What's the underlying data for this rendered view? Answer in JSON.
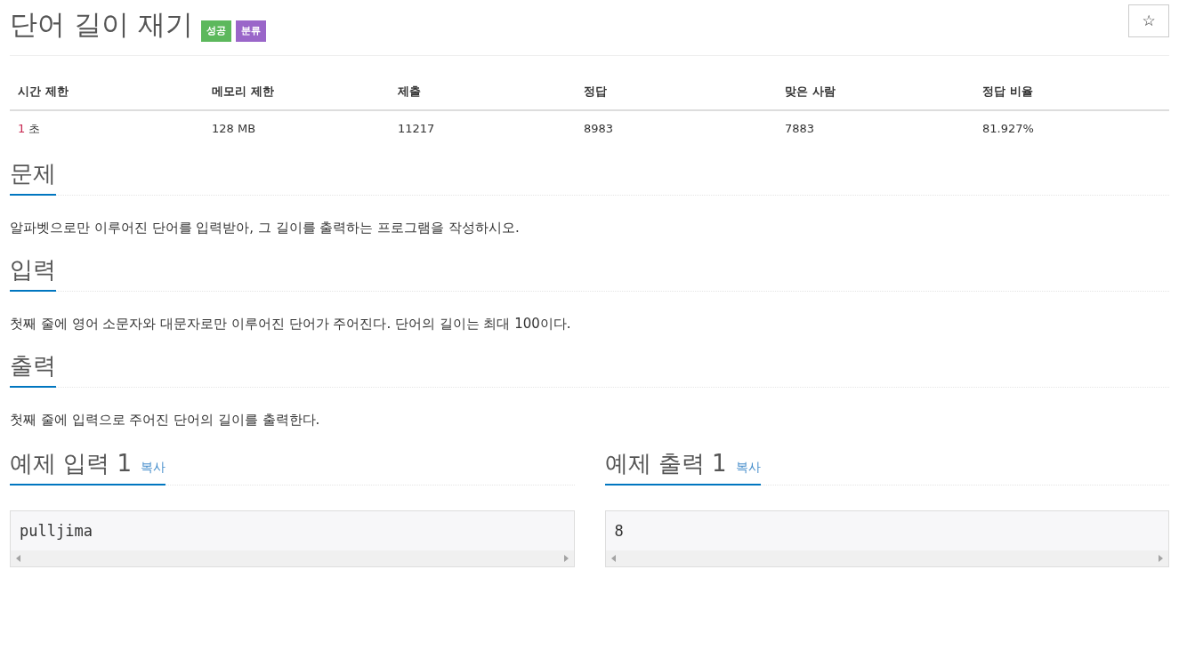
{
  "title": "단어 길이 재기",
  "badges": [
    {
      "label": "성공",
      "color": "#5cb85c"
    },
    {
      "label": "분류",
      "color": "#9a66c9"
    }
  ],
  "star_button": {
    "label": "☆"
  },
  "info_table": {
    "columns": [
      "시간 제한",
      "메모리 제한",
      "제출",
      "정답",
      "맞은 사람",
      "정답 비율"
    ],
    "row": [
      {
        "number": "1",
        "unit": "초"
      },
      {
        "text": "128 MB"
      },
      {
        "text": "11217"
      },
      {
        "text": "8983"
      },
      {
        "text": "7883"
      },
      {
        "text": "81.927%"
      }
    ]
  },
  "sections": [
    {
      "heading": "문제",
      "body": "알파벳으로만 이루어진 단어를 입력받아, 그 길이를 출력하는 프로그램을 작성하시오."
    },
    {
      "heading": "입력",
      "body": "첫째 줄에 영어 소문자와 대문자로만 이루어진 단어가 주어진다. 단어의 길이는 최대 100이다."
    },
    {
      "heading": "출력",
      "body": "첫째 줄에 입력으로 주어진 단어의 길이를 출력한다."
    }
  ],
  "samples": [
    {
      "heading": "예제 입력 1",
      "copy": "복사",
      "content": "pulljima"
    },
    {
      "heading": "예제 출력 1",
      "copy": "복사",
      "content": "8"
    }
  ]
}
